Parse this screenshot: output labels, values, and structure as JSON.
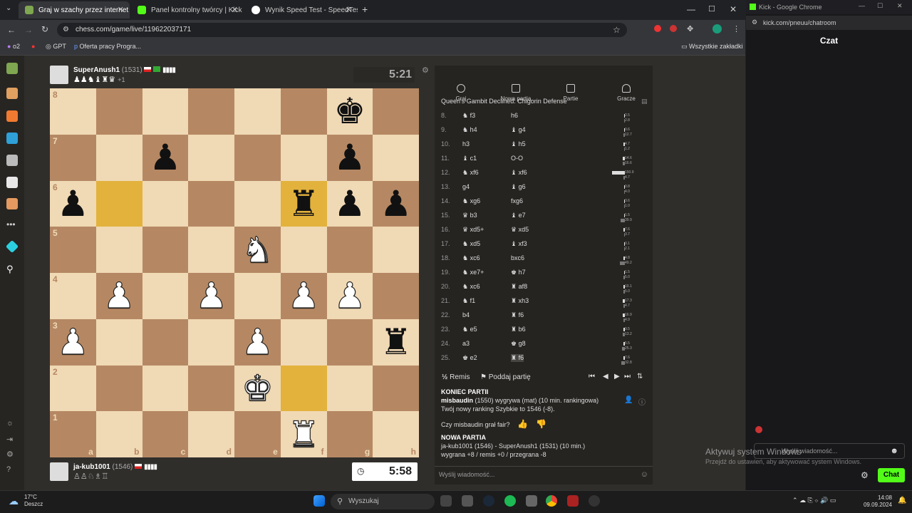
{
  "browser": {
    "tabs": [
      {
        "label": "Graj w szachy przez internet za d",
        "color": "#7fa650"
      },
      {
        "label": "Panel kontrolny twórcy | Kick",
        "color": "#53fc18"
      },
      {
        "label": "Wynik Speed Test - SpeedTest.pl",
        "color": "#ffffff"
      }
    ],
    "url": "chess.com/game/live/119622037171",
    "bookmarks": [
      "o2",
      "GPT",
      "Oferta pracy Progra..."
    ],
    "all_bookmarks": "Wszystkie zakładki"
  },
  "top_player": {
    "name": "SuperAnush1",
    "rating": "(1531)",
    "captured": "♟♟♞♝♜♛",
    "plus": "+1",
    "clock": "5:21"
  },
  "bottom_player": {
    "name": "ja-kub1001",
    "rating": "(1546)",
    "captured": "♙♙♘♗♖",
    "clock": "5:58"
  },
  "board": {
    "ranks": [
      "8",
      "7",
      "6",
      "5",
      "4",
      "3",
      "2",
      "1"
    ],
    "files": [
      "a",
      "b",
      "c",
      "d",
      "e",
      "f",
      "g",
      "h"
    ],
    "pieces": [
      {
        "sq": "g8",
        "glyph": "♚",
        "side": "b",
        "name": "black-king"
      },
      {
        "sq": "c7",
        "glyph": "♟",
        "side": "b",
        "name": "black-pawn"
      },
      {
        "sq": "g7",
        "glyph": "♟",
        "side": "b",
        "name": "black-pawn"
      },
      {
        "sq": "a6",
        "glyph": "♟",
        "side": "b",
        "name": "black-pawn"
      },
      {
        "sq": "f6",
        "glyph": "♜",
        "side": "b",
        "name": "black-rook"
      },
      {
        "sq": "g6",
        "glyph": "♟",
        "side": "b",
        "name": "black-pawn"
      },
      {
        "sq": "h6",
        "glyph": "♟",
        "side": "b",
        "name": "black-pawn"
      },
      {
        "sq": "e5",
        "glyph": "♞",
        "side": "w",
        "name": "white-knight"
      },
      {
        "sq": "b4",
        "glyph": "♟",
        "side": "w",
        "name": "white-pawn"
      },
      {
        "sq": "d4",
        "glyph": "♟",
        "side": "w",
        "name": "white-pawn"
      },
      {
        "sq": "f4",
        "glyph": "♟",
        "side": "w",
        "name": "white-pawn"
      },
      {
        "sq": "g4",
        "glyph": "♟",
        "side": "w",
        "name": "white-pawn"
      },
      {
        "sq": "a3",
        "glyph": "♟",
        "side": "w",
        "name": "white-pawn"
      },
      {
        "sq": "e3",
        "glyph": "♟",
        "side": "w",
        "name": "white-pawn"
      },
      {
        "sq": "h3",
        "glyph": "♜",
        "side": "b",
        "name": "black-rook"
      },
      {
        "sq": "e2",
        "glyph": "♚",
        "side": "w",
        "name": "white-king"
      },
      {
        "sq": "f1",
        "glyph": "♜",
        "side": "w",
        "name": "white-rook"
      }
    ],
    "highlights": [
      "b6",
      "f6",
      "f2"
    ]
  },
  "panel": {
    "tabs": [
      "Graj",
      "Nowa partia",
      "Partie",
      "Gracze"
    ],
    "opening": "Queen's Gambit Declined: Chigorin Defense",
    "moves": [
      {
        "n": "8.",
        "w": "♞ f3",
        "b": "h6",
        "t1": "2.5",
        "t2": "2.8"
      },
      {
        "n": "9.",
        "w": "♞ h4",
        "b": "♝ g4",
        "t1": "0.6",
        "t2": "12.7"
      },
      {
        "n": "10.",
        "w": "h3",
        "b": "♝ h5",
        "t1": "4.7",
        "t2": "1.2"
      },
      {
        "n": "11.",
        "w": "♝ c1",
        "b": "O-O",
        "t1": "14.6",
        "t2": "16.6"
      },
      {
        "n": "12.",
        "w": "♞ xf6",
        "b": "♝ xf6",
        "t1": "150.9",
        "t2": "4.7"
      },
      {
        "n": "13.",
        "w": "g4",
        "b": "♝ g6",
        "t1": "0.8",
        "t2": "4.0"
      },
      {
        "n": "14.",
        "w": "♞ xg6",
        "b": "fxg6",
        "t1": "3.6",
        "t2": "1.0"
      },
      {
        "n": "15.",
        "w": "♛ b3",
        "b": "♝ e7",
        "t1": "1.5",
        "t2": "39.9"
      },
      {
        "n": "16.",
        "w": "♛ xd5+",
        "b": "♛ xd5",
        "t1": "7.6",
        "t2": "3.7"
      },
      {
        "n": "17.",
        "w": "♞ xd5",
        "b": "♝ xf3",
        "t1": "0.1",
        "t2": "2.1"
      },
      {
        "n": "18.",
        "w": "♞ xc6",
        "b": "bxc6",
        "t1": "4.8",
        "t2": "49.2"
      },
      {
        "n": "19.",
        "w": "♞ xe7+",
        "b": "♚ h7",
        "t1": "1.5",
        "t2": "5.0"
      },
      {
        "n": "20.",
        "w": "♞ xc6",
        "b": "♜ af8",
        "t1": "10.1",
        "t2": "5.0"
      },
      {
        "n": "21.",
        "w": "♞ f1",
        "b": "♜ xh3",
        "t1": "17.3",
        "t2": "4.7"
      },
      {
        "n": "22.",
        "w": "b4",
        "b": "♜ f6",
        "t1": "16.9",
        "t2": "4.9"
      },
      {
        "n": "23.",
        "w": "♞ e5",
        "b": "♜ b6",
        "t1": "9.5",
        "t2": "13.2"
      },
      {
        "n": "24.",
        "w": "a3",
        "b": "♚ g8",
        "t1": "5.5",
        "t2": "25.3"
      },
      {
        "n": "25.",
        "w": "♚ e2",
        "b": "♜ f6",
        "t1": "7.6",
        "t2": "32.8"
      }
    ],
    "draw": "Remis",
    "resign": "Poddaj partię",
    "end_title": "KONIEC PARTII",
    "end_winner": "misbaudin",
    "end_line": "(1550) wygrywa (mat) (10 min. rankingowa)",
    "end_rating": "Twój nowy ranking Szybkie to 1546 (-8).",
    "fair_q": "Czy misbaudin grał fair?",
    "new_title": "NOWA PARTIA",
    "new_line": "ja-kub1001 (1546) - SuperAnush1 (1531) (10 min.)",
    "new_stats": "wygrana +8 / remis +0 / przegrana -8",
    "message_placeholder": "Wyślij wiadomość..."
  },
  "kick": {
    "title": "Kick - Google Chrome",
    "url": "kick.com/pneuu/chatroom",
    "header": "Czat",
    "input_placeholder": "Wyślij wiadomość...",
    "chat_button": "Chat"
  },
  "watermark": {
    "line1": "Aktywuj system Windows",
    "line2": "Przejdź do ustawień, aby aktywować system Windows."
  },
  "taskbar": {
    "temp": "17°C",
    "weather": "Deszcz",
    "search": "Wyszukaj",
    "time": "14:08",
    "date": "09.09.2024"
  }
}
